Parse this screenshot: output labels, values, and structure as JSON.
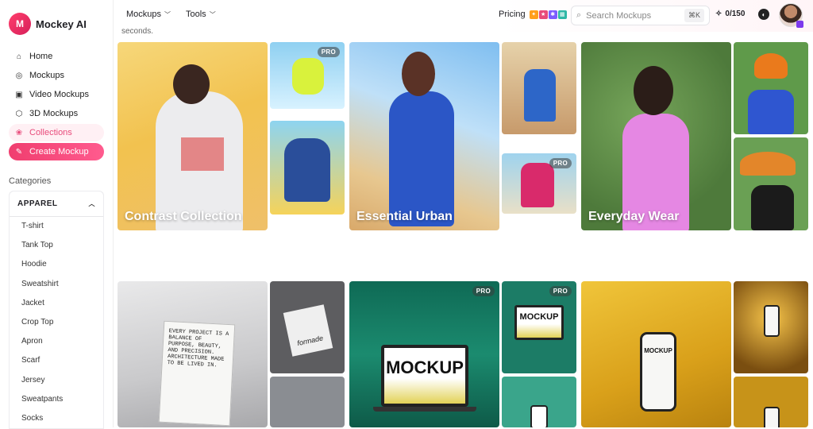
{
  "brand": {
    "name": "Mockey AI",
    "logo_mark": "M"
  },
  "sidebar": {
    "nav": [
      {
        "label": "Home",
        "icon": "home-icon"
      },
      {
        "label": "Mockups",
        "icon": "globe-icon"
      },
      {
        "label": "Video Mockups",
        "icon": "video-icon"
      },
      {
        "label": "3D Mockups",
        "icon": "cube-icon"
      },
      {
        "label": "Collections",
        "icon": "collections-icon"
      },
      {
        "label": "Create Mockup",
        "icon": "create-icon"
      }
    ],
    "categories_heading": "Categories",
    "category_group": "APPAREL",
    "category_items": [
      "T-shirt",
      "Tank Top",
      "Hoodie",
      "Sweatshirt",
      "Jacket",
      "Crop Top",
      "Apron",
      "Scarf",
      "Jersey",
      "Sweatpants",
      "Socks"
    ]
  },
  "topbar": {
    "menu": [
      "Mockups",
      "Tools"
    ],
    "pricing": "Pricing",
    "search_placeholder": "Search Mockups",
    "search_shortcut": "⌘K",
    "credits": "0/150"
  },
  "content": {
    "intro_fragment": "seconds.",
    "pro_label": "PRO",
    "collections": [
      {
        "title": "Contrast Collection"
      },
      {
        "title": "Essential Urban"
      },
      {
        "title": "Everyday Wear"
      }
    ],
    "mock_texts": {
      "poster": "EVERY PROJECT IS A BALANCE OF PURPOSE, BEAUTY, AND PRECISION. ARCHITECTURE MADE TO BE LIVED IN.",
      "book": "formade",
      "laptop_big": "MOCKUP",
      "laptop_small": "MOCKUP",
      "phone": "MOCKUP"
    }
  },
  "colors": {
    "accent": "#f03e6f",
    "accent_soft": "#fff0f4",
    "credits_icon": "#111111"
  }
}
